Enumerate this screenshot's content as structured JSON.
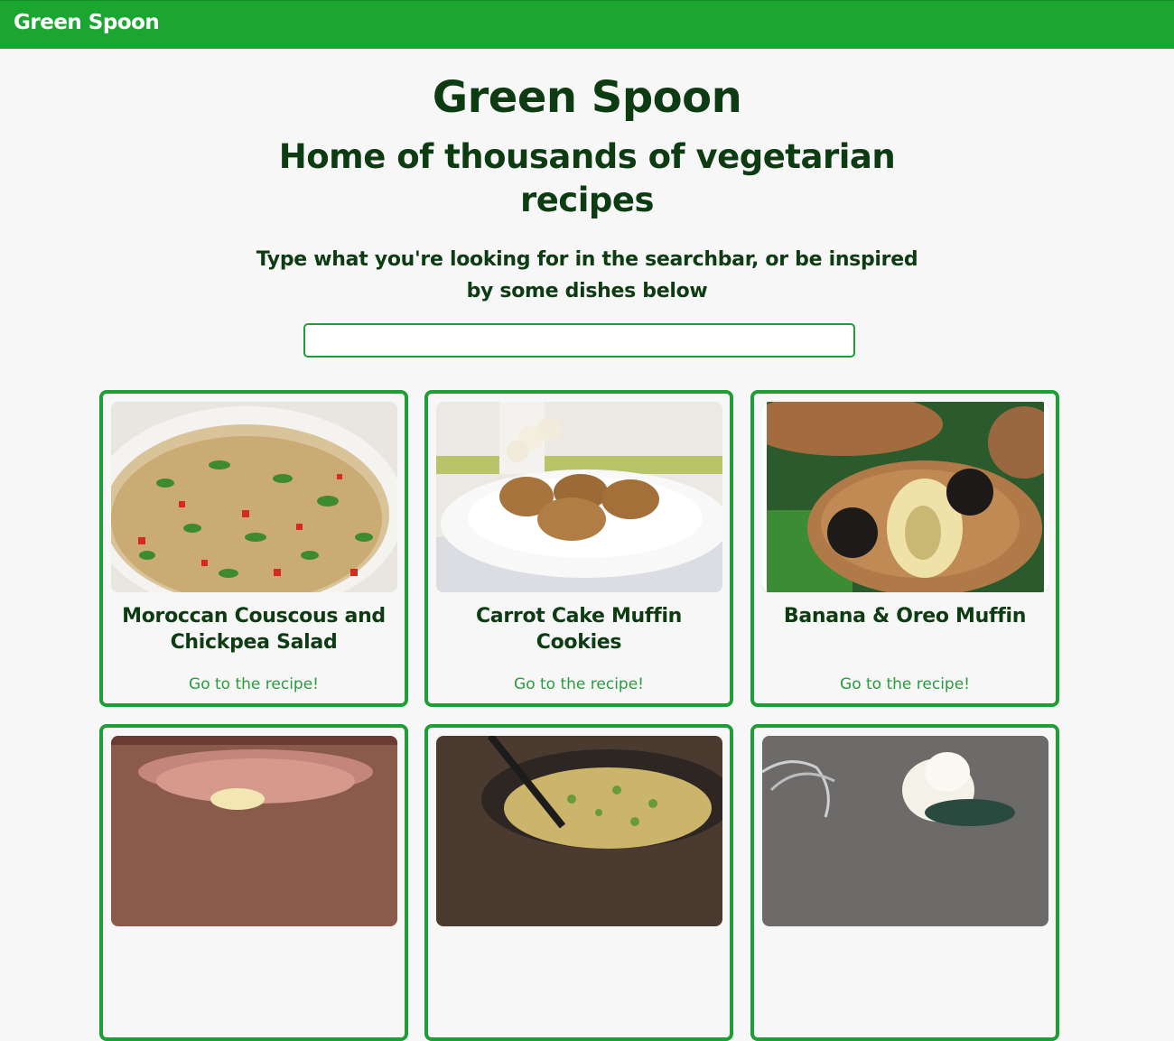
{
  "nav": {
    "brand": "Green Spoon"
  },
  "hero": {
    "title": "Green Spoon",
    "subtitle": "Home of thousands of vegetarian recipes",
    "intro": "Type what you're looking for in the searchbar, or be inspired by some dishes below"
  },
  "search": {
    "value": "",
    "placeholder": ""
  },
  "recipes": [
    {
      "title": "Moroccan Couscous and Chickpea Salad",
      "link": "Go to the recipe!"
    },
    {
      "title": "Carrot Cake Muffin Cookies",
      "link": "Go to the recipe!"
    },
    {
      "title": "Banana & Oreo Muffin",
      "link": "Go to the recipe!"
    },
    {
      "title": "",
      "link": ""
    },
    {
      "title": "",
      "link": ""
    },
    {
      "title": "",
      "link": ""
    }
  ],
  "colors": {
    "brand_green": "#1aa631",
    "dark_green": "#0d3b12",
    "border_green": "#1f9e35",
    "page_bg": "#f7f7f7"
  }
}
